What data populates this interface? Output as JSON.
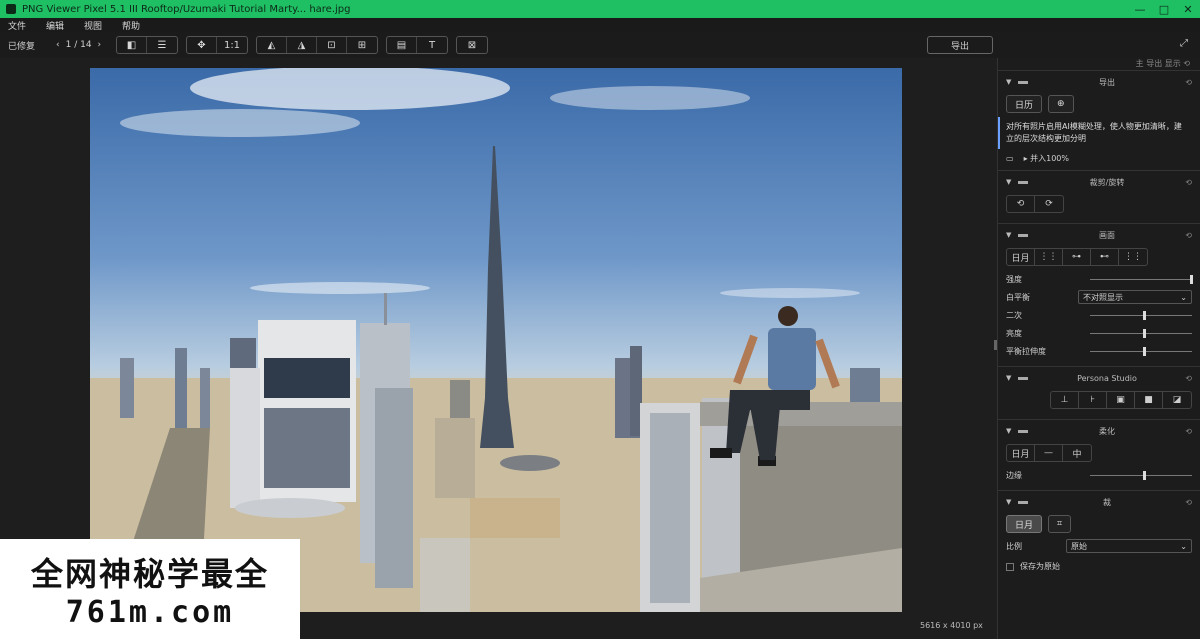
{
  "titlebar": {
    "title": "PNG Viewer Pixel 5.1  III  Rooftop/Uzumaki Tutorial Marty... hare.jpg",
    "controls": [
      "—",
      "□",
      "✕"
    ]
  },
  "menu": {
    "items": [
      "文件",
      "编辑",
      "视图",
      "帮助"
    ]
  },
  "toolbar": {
    "mode_label": "已修复",
    "pager_prev": "‹",
    "pager_text": "1 / 14",
    "pager_next": "›",
    "groups": [
      [
        "◧",
        "☰"
      ],
      [
        "✥",
        "1:1"
      ],
      [
        "◭",
        "◮",
        "⊡",
        "⊞"
      ],
      [
        "▤",
        "T"
      ],
      [
        "⊠"
      ]
    ],
    "right_button": "导出",
    "collapse": "⤢"
  },
  "image": {
    "size_text": "5616 x 4010 px"
  },
  "watermark": {
    "line1": "全网神秘学最全",
    "line2": "761m.com"
  },
  "panel": {
    "top_text": "主 导出 显示 ⟲",
    "sec1": {
      "name": "导出",
      "btn1": "日历",
      "btn2": "⊕",
      "note": "对所有照片启用AI模糊处理，使人物更加清晰，建立的层次结构更加分明",
      "file_icon": "folder-icon",
      "file_text": "▸ 并入100%"
    },
    "sec2": {
      "name": "裁剪/旋转",
      "icons": [
        "⟲",
        "⟳"
      ]
    },
    "sec3": {
      "name": "画面",
      "icons": [
        "日月",
        "⋮⋮",
        "⊶",
        "⊷",
        "⋮⋮"
      ],
      "rows": [
        {
          "label": "强度",
          "value": 0.98
        },
        {
          "label": "白平衡",
          "select": "不对照显示"
        },
        {
          "label": "二次",
          "value": 0.52
        },
        {
          "label": "亮度",
          "value": 0.52
        },
        {
          "label": "平衡拉伸度",
          "value": 0.52
        }
      ]
    },
    "sec4": {
      "name": "Persona Studio",
      "icons": [
        "⊥",
        "⊦",
        "▣",
        "■",
        "◪"
      ]
    },
    "sec5": {
      "name": "柔化",
      "icons": [
        "日月",
        "—",
        "中"
      ],
      "row": {
        "label": "边缘",
        "value": 0.52
      }
    },
    "sec6": {
      "name": "裁",
      "btn_active": "日月",
      "btn2": "⌗",
      "select_label": "比例",
      "select_value": "原始",
      "checkbox": "保存为原始"
    }
  }
}
